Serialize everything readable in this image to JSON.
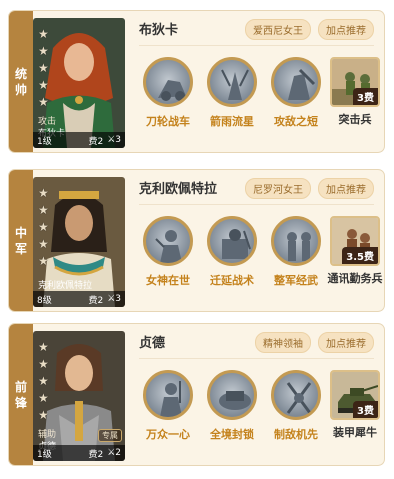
{
  "heroes": [
    {
      "role": "统帅",
      "name": "布狄卡",
      "sub": "攻击",
      "portrait_name": "布狄卡",
      "level": "1级",
      "cost": "费2",
      "count": "3",
      "tags": [
        "爱西尼女王",
        "加点推荐"
      ],
      "skills": [
        "刀轮战车",
        "箭雨流星",
        "攻敌之短"
      ],
      "unit": {
        "label": "突击兵",
        "cost": "3费"
      }
    },
    {
      "role": "中军",
      "name": "克利欧佩特拉",
      "sub": "",
      "portrait_name": "克利欧佩特拉",
      "level": "8级",
      "cost": "费2",
      "count": "3",
      "tags": [
        "尼罗河女王",
        "加点推荐"
      ],
      "skills": [
        "女神在世",
        "迁延战术",
        "整军经武"
      ],
      "unit": {
        "label": "通讯勤务兵",
        "cost": "3.5费"
      }
    },
    {
      "role": "前锋",
      "name": "贞德",
      "sub": "辅助",
      "portrait_name": "贞德",
      "level": "1级",
      "cost": "费2",
      "count": "2",
      "tag_badge": "专属",
      "tags": [
        "精神领袖",
        "加点推荐"
      ],
      "skills": [
        "万众一心",
        "全境封锁",
        "制敌机先"
      ],
      "unit": {
        "label": "装甲犀牛",
        "cost": "3费"
      }
    }
  ],
  "star": "★",
  "colors": {
    "accent": "#b5843f",
    "skill_text": "#c4821c",
    "card_bg": "#fbf4e6"
  }
}
